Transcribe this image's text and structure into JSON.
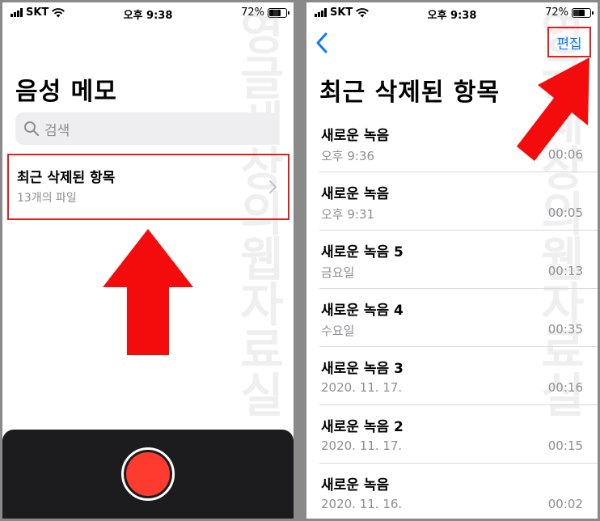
{
  "status_bar": {
    "carrier": "SKT",
    "time": "오후 9:38",
    "battery_percent_label": "72%",
    "battery_level": 0.72
  },
  "left_screen": {
    "title": "음성 메모",
    "search_placeholder": "검색",
    "folder": {
      "title": "최근 삭제된 항목",
      "subtitle": "13개의 파일"
    }
  },
  "right_screen": {
    "edit_label": "편집",
    "title": "최근 삭제된 항목",
    "recordings": [
      {
        "title": "새로운 녹음",
        "date": "오후 9:36",
        "duration": "00:06"
      },
      {
        "title": "새로운 녹음",
        "date": "오후 9:31",
        "duration": "00:05"
      },
      {
        "title": "새로운 녹음 5",
        "date": "금요일",
        "duration": "00:13"
      },
      {
        "title": "새로운 녹음 4",
        "date": "수요일",
        "duration": "00:35"
      },
      {
        "title": "새로운 녹음 3",
        "date": "2020. 11. 17.",
        "duration": "00:16"
      },
      {
        "title": "새로운 녹음 2",
        "date": "2020. 11. 17.",
        "duration": "00:15"
      },
      {
        "title": "새로운 녹음",
        "date": "2020. 11. 16.",
        "duration": "00:02"
      }
    ]
  },
  "watermark": "영글세상의웹자료실",
  "colors": {
    "accent_blue": "#0a7aff",
    "highlight_red": "#e0201a",
    "record_red": "#ff3b30",
    "secondary_gray": "#8e8e93"
  },
  "icons": {
    "wifi": "wifi-icon",
    "battery": "battery-icon",
    "signal": "signal-icon",
    "search": "search-icon",
    "chevron_right": "chevron-right-icon",
    "chevron_left": "chevron-left-icon",
    "record": "record-icon",
    "arrow": "arrow-up-icon"
  }
}
